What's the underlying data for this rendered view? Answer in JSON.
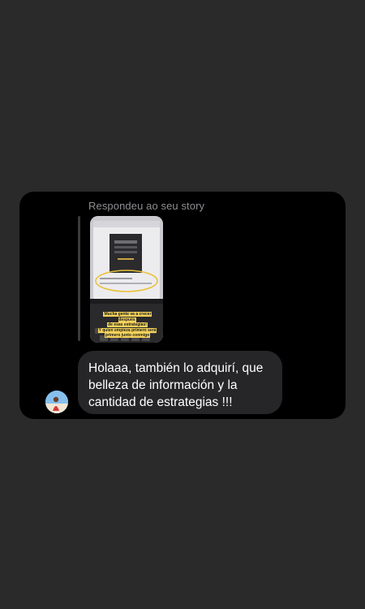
{
  "colors": {
    "background": "#2a2a2b",
    "card": "#000000",
    "bubble": "#262628",
    "header_text": "#8e8e93",
    "message_text": "#ffffff"
  },
  "reply": {
    "header": "Respondeu ao seu story"
  },
  "story": {
    "caption_lines": [
      "Mucha gente va a crecer después",
      "de esas estrategias!",
      "Y quien empieza primero será",
      "primero junto conmigo"
    ]
  },
  "message": {
    "text": "Holaaa, también lo adquirí, que belleza de información y la cantidad de estrategias !!!"
  },
  "avatar": {
    "icon": "user-avatar-photo"
  }
}
